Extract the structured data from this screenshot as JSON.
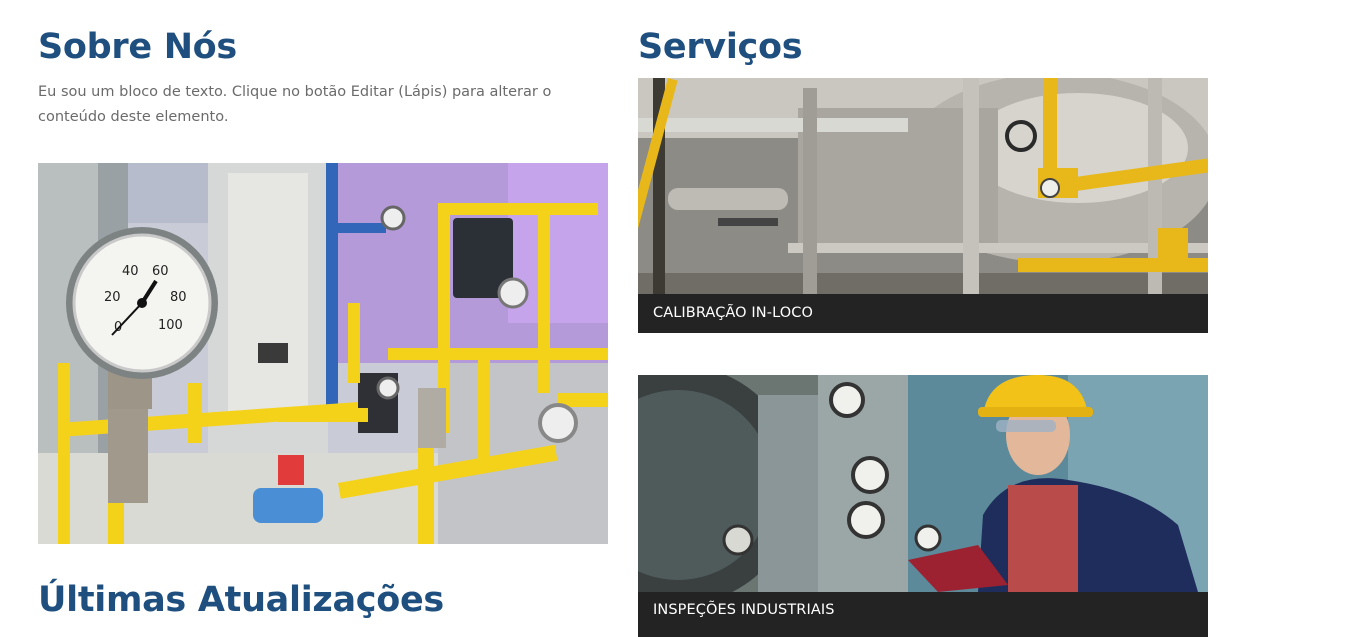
{
  "about": {
    "title": "Sobre Nós",
    "text": "Eu sou um bloco de texto. Clique no botão Editar (Lápis) para alterar o conteúdo deste elemento.",
    "image_alt": "Painel de manômetros e tubulação amarela de gás em laboratório"
  },
  "updates": {
    "title": "Últimas Atualizações"
  },
  "services": {
    "title": "Serviços",
    "items": [
      {
        "label": "CALIBRAÇÃO IN-LOCO",
        "image_alt": "Tubulações industriais com válvulas amarelas"
      },
      {
        "label": "INSPEÇÕES INDUSTRIAIS",
        "image_alt": "Técnico com capacete amarelo inspecionando caldeira"
      }
    ]
  },
  "colors": {
    "heading": "#1e4f7f",
    "body_text": "#6b6b6b",
    "caption_bar": "#232323",
    "caption_text": "#ffffff"
  }
}
